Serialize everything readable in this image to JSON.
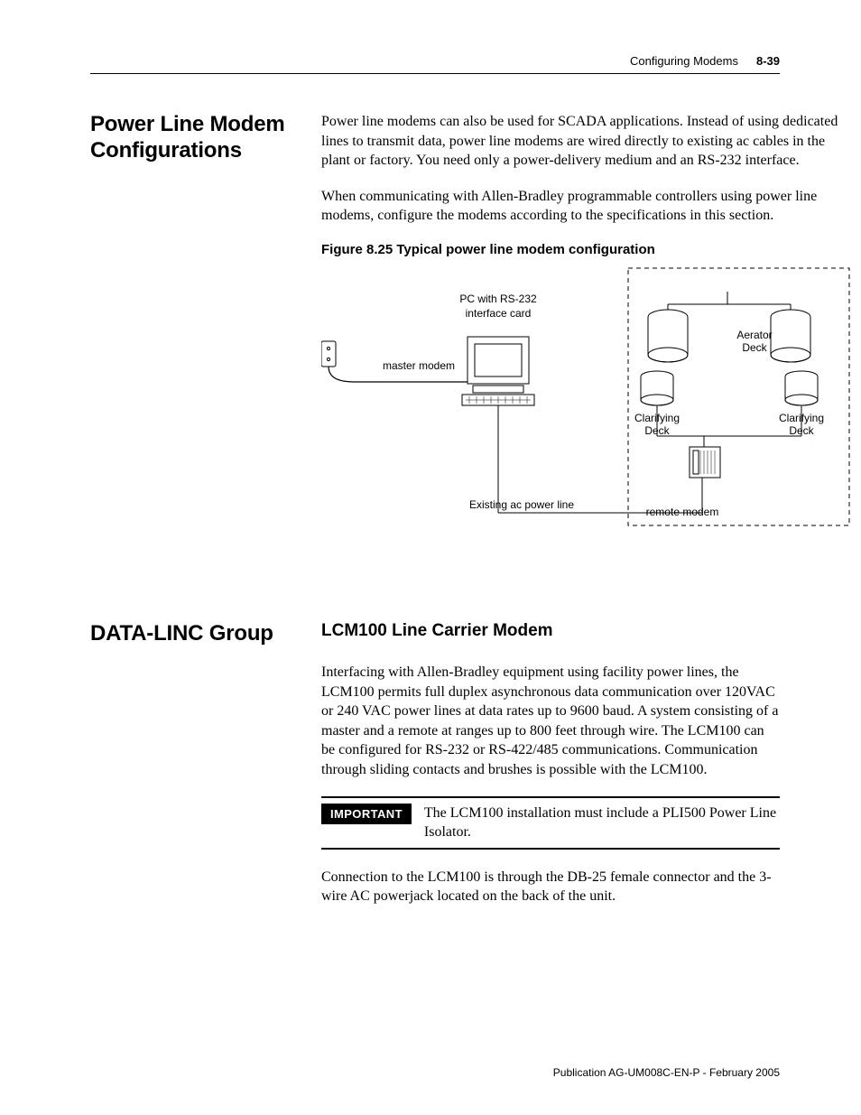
{
  "running_head": {
    "section_title": "Configuring Modems",
    "page_number": "8-39"
  },
  "section1": {
    "side_title": "Power Line Modem Configurations",
    "para1": "Power line modems can also be used for SCADA applications. Instead of using dedicated lines to transmit data, power line modems are wired directly to existing ac cables in the plant or factory. You need only a power-delivery medium and an RS-232 interface.",
    "para2": "When communicating with Allen-Bradley programmable controllers using power line modems, configure the modems according to the specifications in this section.",
    "figure_title": "Figure 8.25 Typical power line modem configuration",
    "figure_labels": {
      "pc_line1": "PC with RS-232",
      "pc_line2": "interface card",
      "master_modem": "master modem",
      "existing_line": "Existing ac power line",
      "remote_modem": "remote modem",
      "aerator_line1": "Aerator",
      "aerator_line2": "Deck",
      "clarify_a_line1": "Clarifying",
      "clarify_a_line2": "Deck",
      "clarify_b_line1": "Clarifying",
      "clarify_b_line2": "Deck"
    }
  },
  "section2": {
    "side_title": "DATA-LINC Group",
    "subhead": "LCM100 Line Carrier Modem",
    "para1": "Interfacing with Allen-Bradley equipment using facility power lines, the LCM100 permits full duplex asynchronous data communication over 120VAC or 240 VAC power lines at data rates up to 9600 baud. A system consisting of a master and a remote at ranges up to 800 feet through wire. The LCM100 can be configured for RS-232 or RS-422/485 communications. Communication through sliding contacts and brushes is possible with the LCM100.",
    "important_label": "IMPORTANT",
    "important_text": "The LCM100 installation must include a PLI500 Power Line Isolator.",
    "para2": "Connection to the LCM100 is through the DB-25 female connector and the 3-wire AC powerjack located on the back of the unit."
  },
  "footer": {
    "publication": "Publication AG-UM008C-EN-P - February 2005"
  }
}
